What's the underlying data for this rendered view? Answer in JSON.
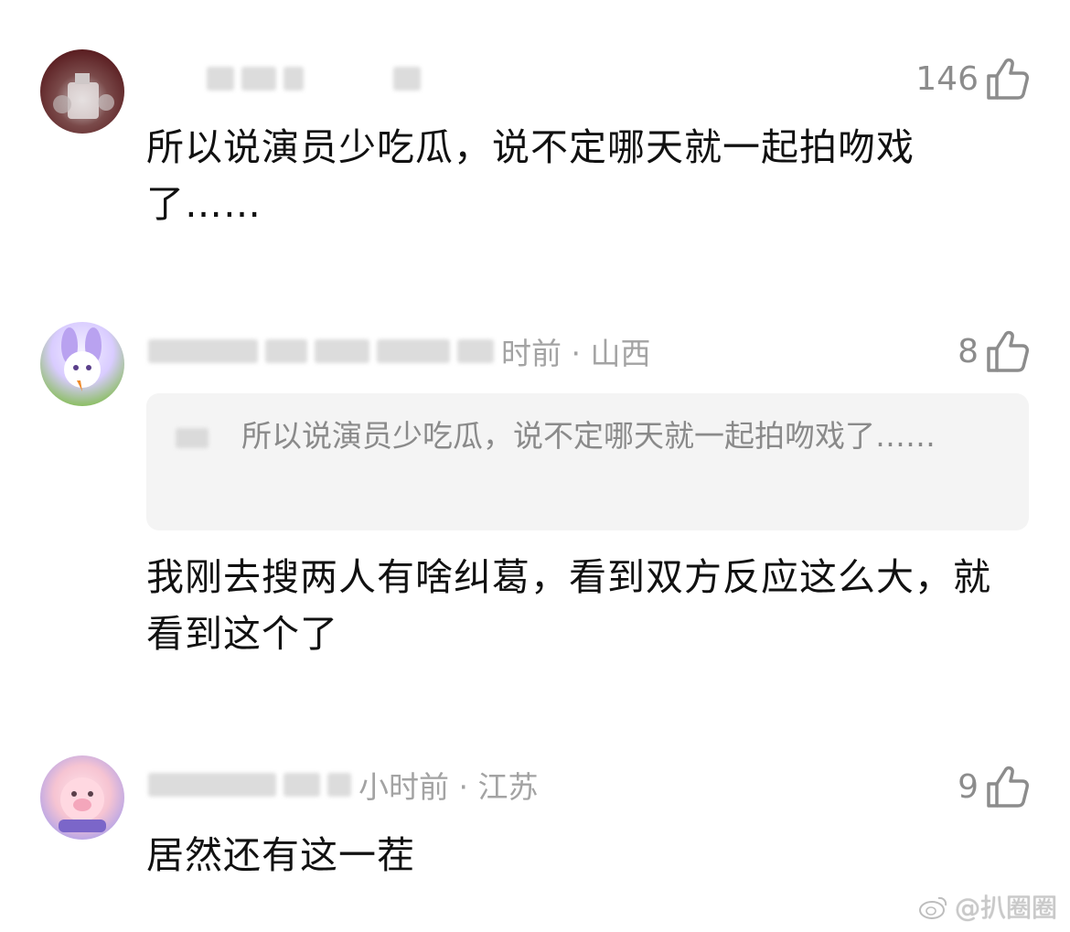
{
  "comments": [
    {
      "meta": "",
      "likes": "146",
      "content": "所以说演员少吃瓜，说不定哪天就一起拍吻戏了……"
    },
    {
      "meta": "时前 · 山西",
      "likes": "8",
      "quote": "所以说演员少吃瓜，说不定哪天就一起拍吻戏了……",
      "content": "我刚去搜两人有啥纠葛，看到双方反应这么大，就看到这个了"
    },
    {
      "meta": "小时前 · 江苏",
      "likes": "9",
      "content": "居然还有这一茬"
    }
  ],
  "watermark": "@扒圈圈",
  "icons": {
    "like": "thumbs-up-icon",
    "brand": "weibo-icon"
  },
  "colors": {
    "meta_text": "#a3a3a3",
    "like_text": "#8c8c8c",
    "quote_bg": "#f4f4f4"
  }
}
